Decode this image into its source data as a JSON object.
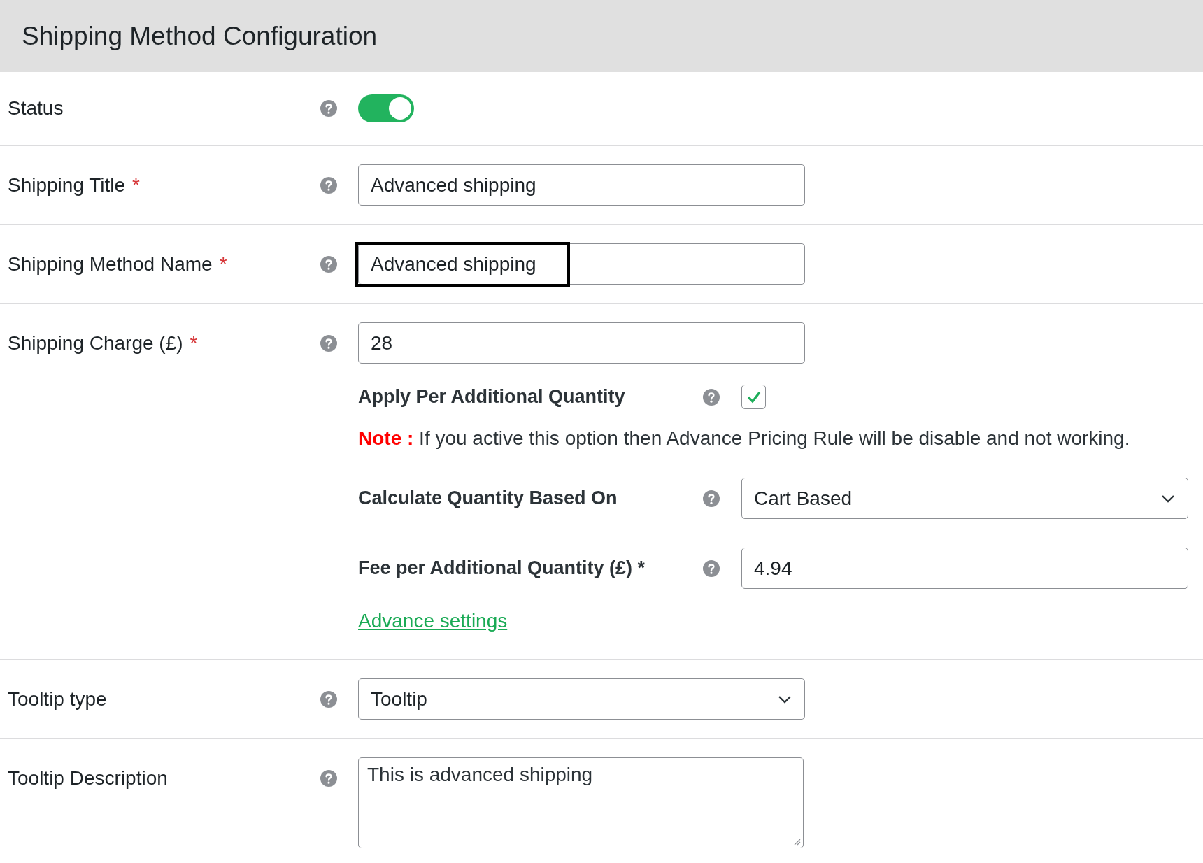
{
  "header": {
    "title": "Shipping Method Configuration"
  },
  "rows": [
    {
      "kind": "toggle",
      "label": "Status",
      "on": true
    },
    {
      "kind": "text",
      "label": "Shipping Title",
      "required_mark": "*",
      "value": "Advanced shipping",
      "highlighted": false
    },
    {
      "kind": "text",
      "label": "Shipping Method Name",
      "required_mark": "*",
      "value": "Advanced shipping",
      "highlighted": true
    },
    {
      "kind": "text",
      "label": "Shipping Charge (£)",
      "required_mark": "*",
      "value": "28",
      "highlighted": false,
      "details": {
        "per_quantity": {
          "label": "Apply Per Additional Quantity",
          "checked": true
        },
        "note": {
          "prefix": "Note :",
          "text": "If you active this option then Advance Pricing Rule will be disable and not working."
        },
        "quantity_basis": {
          "label": "Calculate Quantity Based On",
          "value": "Cart Based"
        },
        "fee": {
          "label": "Fee per Additional Quantity (£) *",
          "value": "4.94"
        },
        "link": "Advance settings"
      }
    },
    {
      "kind": "select",
      "label": "Tooltip type",
      "value": "Tooltip"
    },
    {
      "kind": "textarea",
      "label": "Tooltip Description",
      "value": "This is advanced shipping"
    }
  ]
}
